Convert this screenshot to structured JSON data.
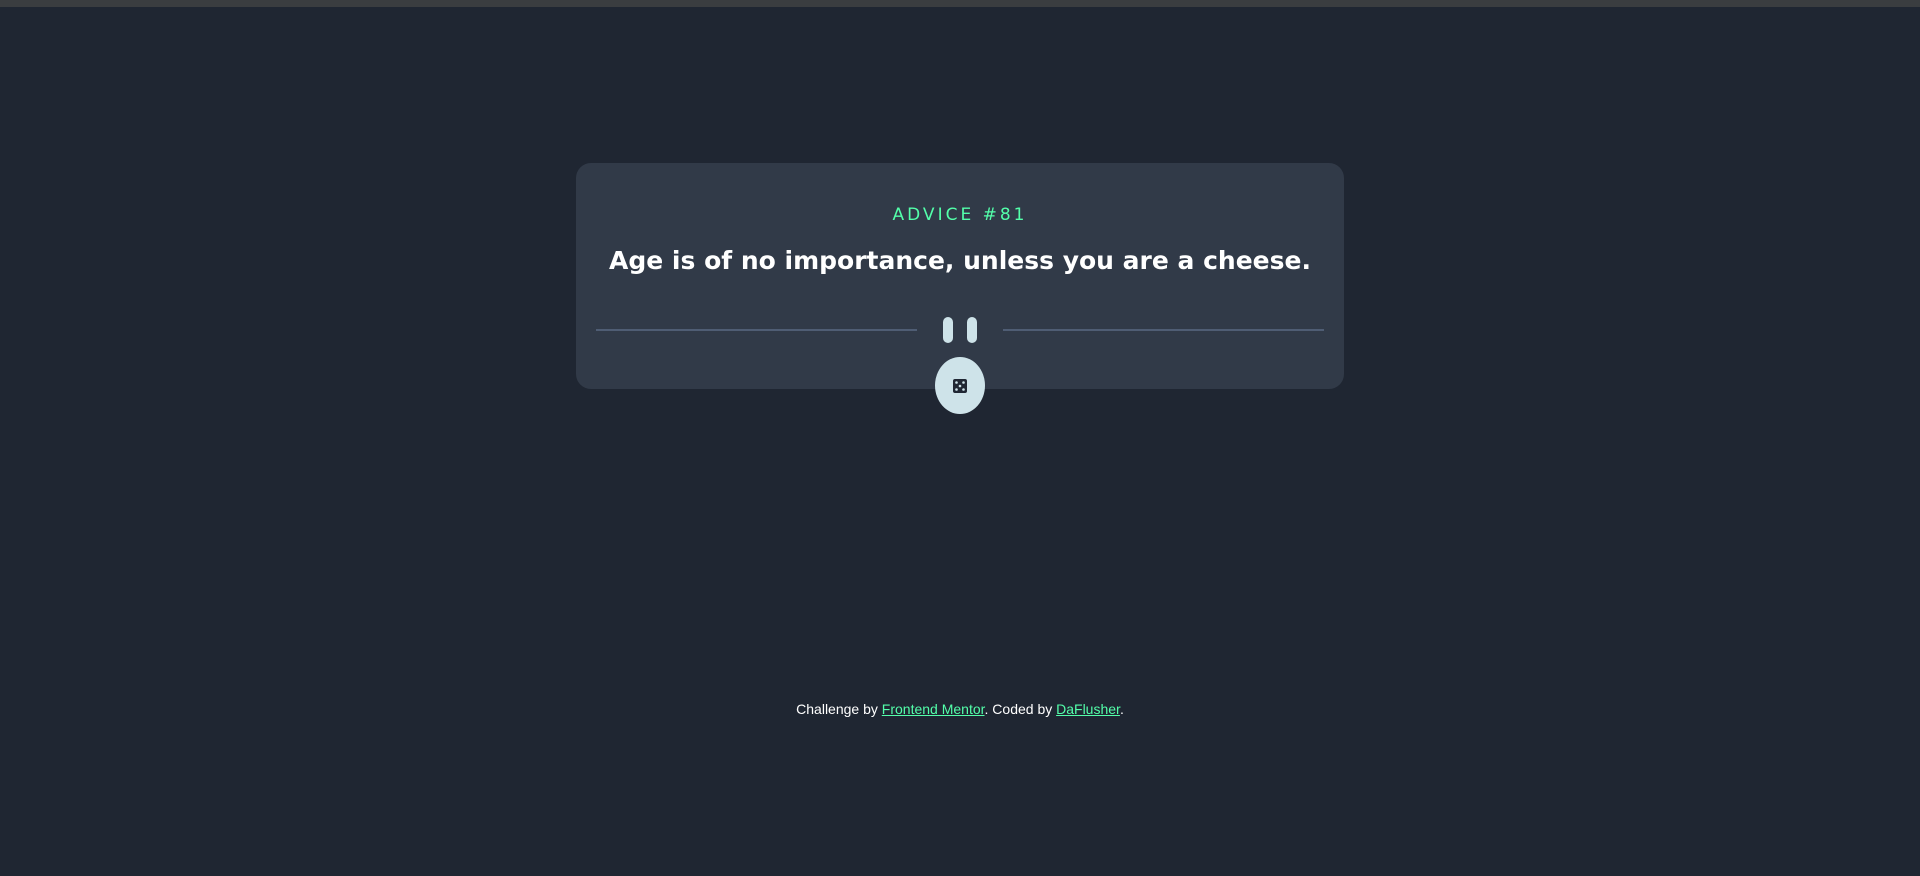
{
  "advice": {
    "id_label": "ADVICE #81",
    "text": "Age is of no importance, unless you are a cheese."
  },
  "controls": {
    "dice_icon": "dice-icon",
    "divider_icon": "pause-icon"
  },
  "footer": {
    "prefix": "Challenge by ",
    "challenge_link": "Frontend Mentor",
    "middle": ". Coded by ",
    "author_link": "DaFlusher",
    "suffix": "."
  },
  "colors": {
    "background": "#1f2632",
    "card": "#313a48",
    "accent": "#53ffaa",
    "button": "#cee3e9",
    "divider": "#4f5d74"
  }
}
